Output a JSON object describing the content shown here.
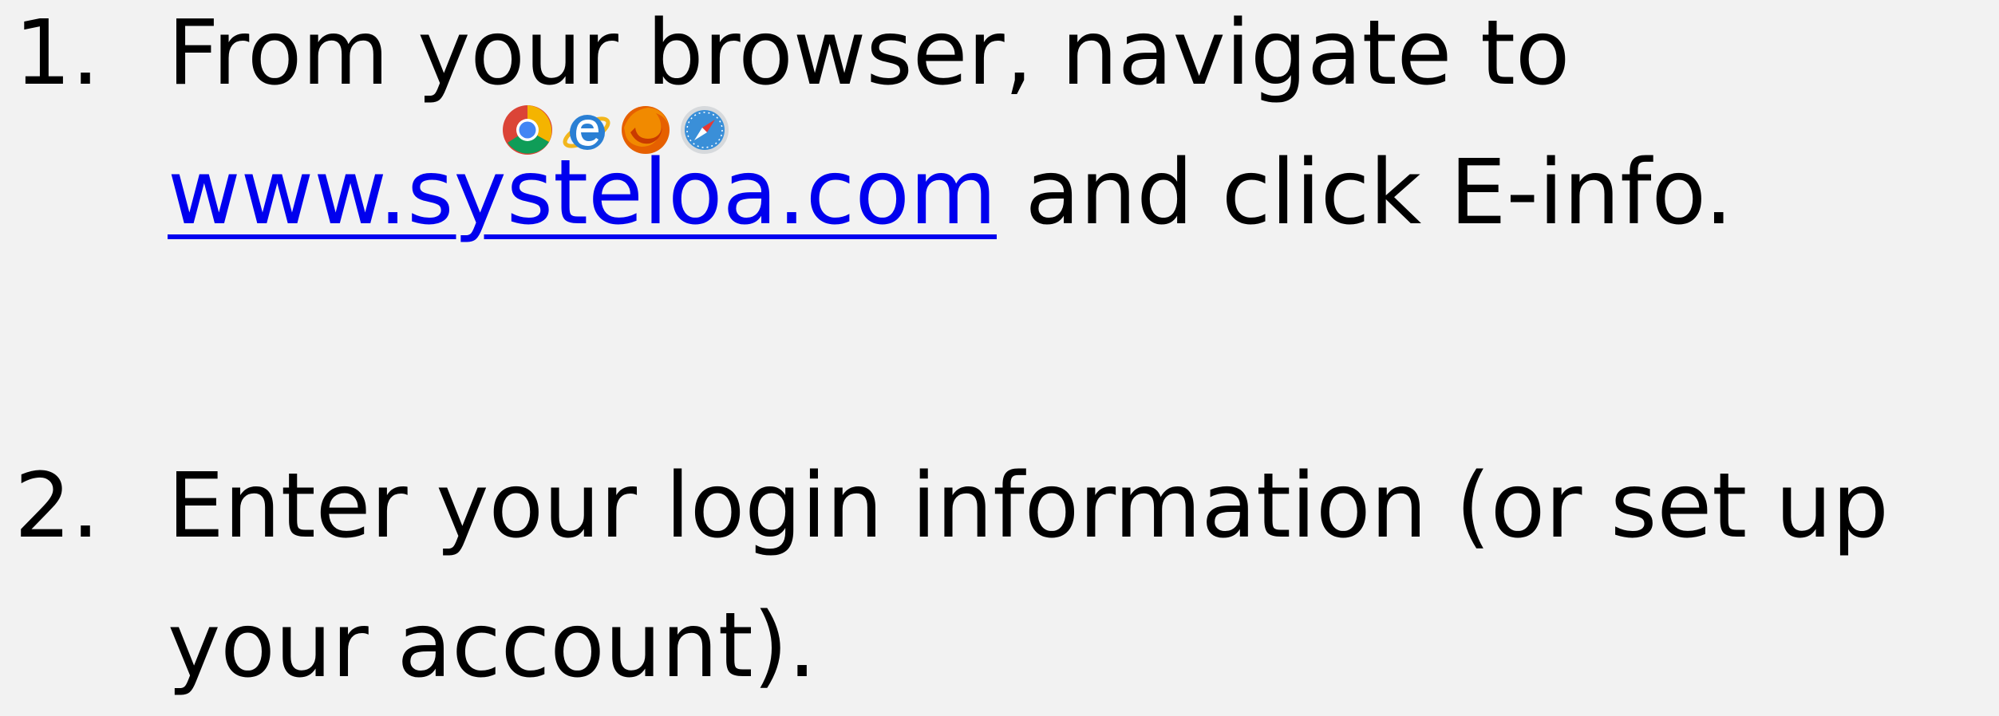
{
  "steps": [
    {
      "number": "1.",
      "line1": "From your browser, navigate to",
      "link_text": "www.systeloa.com",
      "line2_rest": " and click E-info."
    },
    {
      "number": "2.",
      "line1": "Enter your login information (or set up",
      "line2": "your account)."
    }
  ],
  "icons": [
    "chrome-icon",
    "internet-explorer-icon",
    "firefox-icon",
    "safari-icon"
  ],
  "colors": {
    "background": "#f2f2f2",
    "text": "#000000",
    "link": "#0000ee"
  }
}
